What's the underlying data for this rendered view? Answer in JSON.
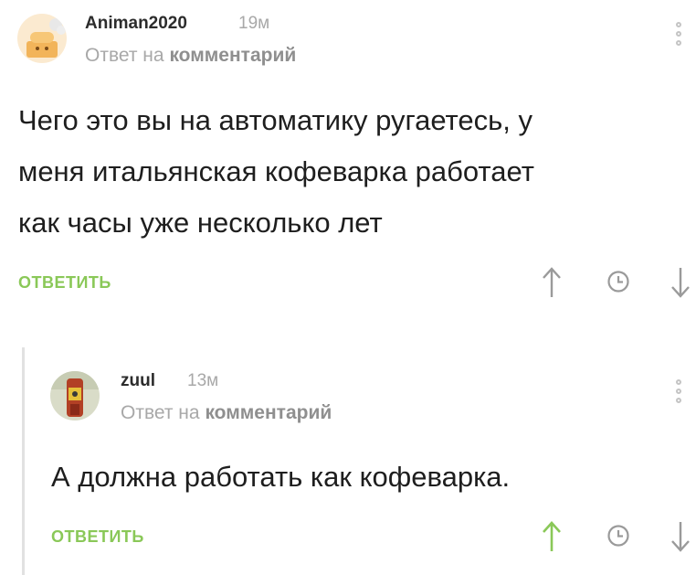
{
  "comments": [
    {
      "username": "Animan2020",
      "time": "19м",
      "reply_prefix": "Ответ на",
      "reply_link": "комментарий",
      "text_lines": [
        "Чего это вы на автоматику ругаетесь, у",
        "меня итальянская кофеварка работает",
        "как часы уже несколько лет"
      ],
      "reply_button": "ОТВЕТИТЬ"
    },
    {
      "username": "zuul",
      "time": "13м",
      "reply_prefix": "Ответ на",
      "reply_link": "комментарий",
      "text_lines": [
        "А должна работать как кофеварка."
      ],
      "reply_button": "ОТВЕТИТЬ"
    }
  ],
  "colors": {
    "accent_green": "#8ac858",
    "muted_gray": "#a8a8a8",
    "icon_gray": "#9a9a9a"
  }
}
